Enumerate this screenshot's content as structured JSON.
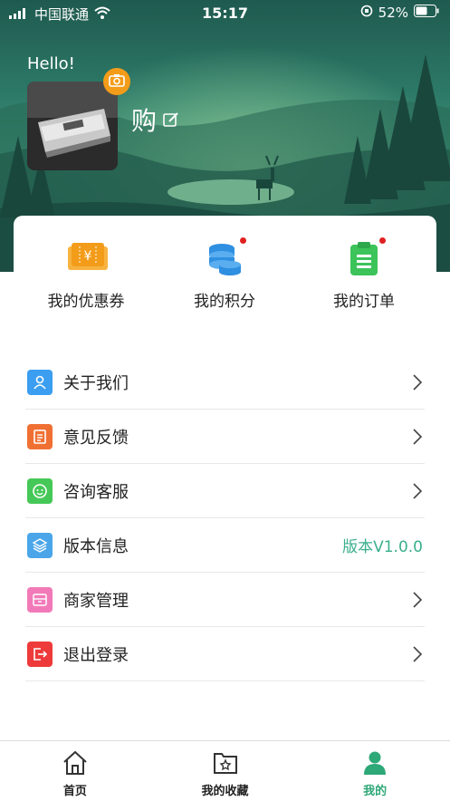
{
  "status_bar": {
    "carrier": "中国联通",
    "time": "15:17",
    "battery": "52%"
  },
  "header": {
    "greeting": "Hello!",
    "username": "购"
  },
  "quick_actions": [
    {
      "label": "我的优惠券",
      "icon": "coupon-icon",
      "color": "#f39c1a",
      "dot": false
    },
    {
      "label": "我的积分",
      "icon": "points-coins-icon",
      "color": "#2f8fe0",
      "dot": true
    },
    {
      "label": "我的订单",
      "icon": "order-clipboard-icon",
      "color": "#3cc35a",
      "dot": true
    }
  ],
  "menu": [
    {
      "label": "关于我们",
      "icon": "about-user-icon",
      "color": "#3b9ef0"
    },
    {
      "label": "意见反馈",
      "icon": "feedback-doc-icon",
      "color": "#f07033"
    },
    {
      "label": "咨询客服",
      "icon": "customer-service-icon",
      "color": "#45c857"
    },
    {
      "label": "版本信息",
      "icon": "layers-icon",
      "color": "#4aa6e8",
      "value": "版本V1.0.0"
    },
    {
      "label": "商家管理",
      "icon": "merchant-icon",
      "color": "#f27ab8"
    },
    {
      "label": "退出登录",
      "icon": "logout-icon",
      "color": "#ee3a3a"
    }
  ],
  "tabs": [
    {
      "label": "首页",
      "icon": "home-icon",
      "active": false
    },
    {
      "label": "我的收藏",
      "icon": "favorites-folder-icon",
      "active": false
    },
    {
      "label": "我的",
      "icon": "profile-icon",
      "active": true
    }
  ],
  "colors": {
    "accent": "#2fa878",
    "version_text": "#3aaf8c"
  }
}
